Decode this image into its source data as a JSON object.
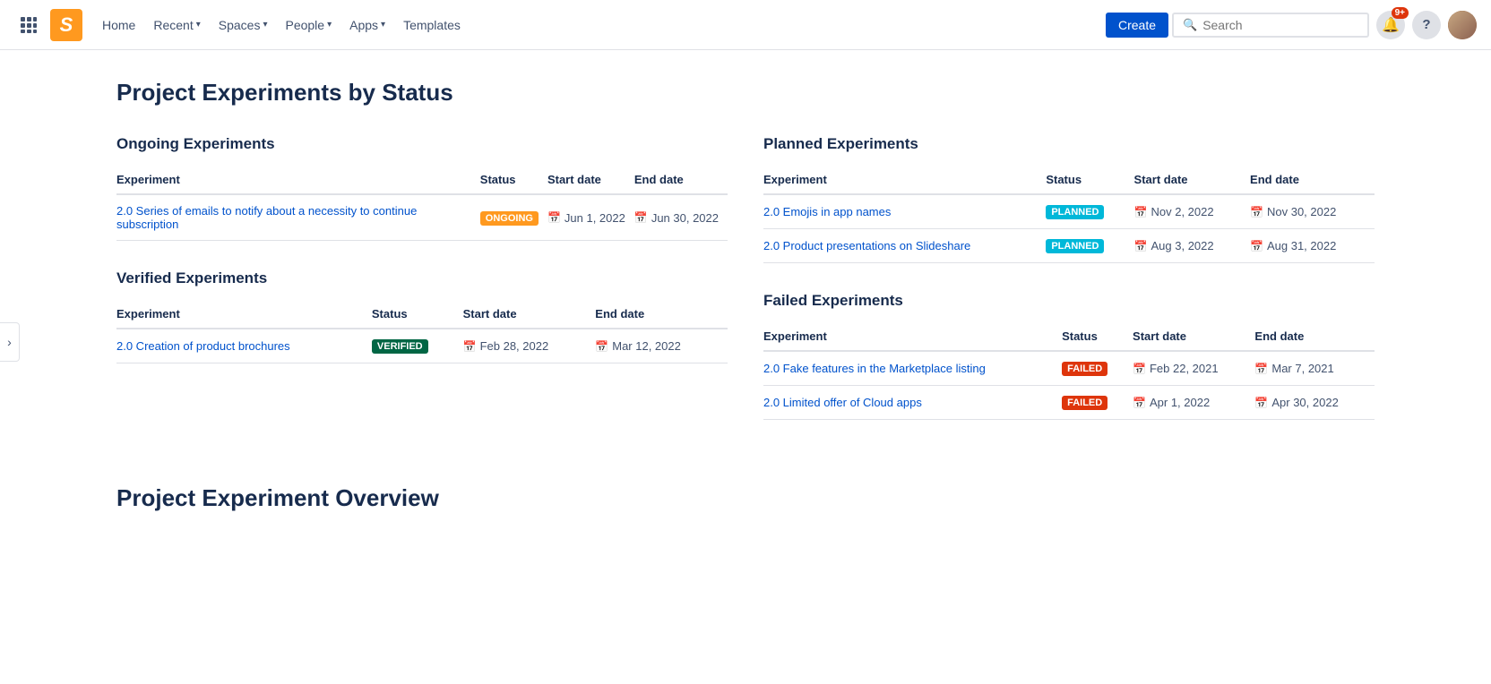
{
  "topnav": {
    "logo_letter": "S",
    "home_label": "Home",
    "recent_label": "Recent",
    "spaces_label": "Spaces",
    "people_label": "People",
    "apps_label": "Apps",
    "templates_label": "Templates",
    "create_label": "Create",
    "search_placeholder": "Search",
    "notif_count": "9+",
    "help_label": "?"
  },
  "page": {
    "title": "Project Experiments by Status",
    "overview_title": "Project Experiment Overview"
  },
  "ongoing": {
    "section_title": "Ongoing Experiments",
    "col_experiment": "Experiment",
    "col_status": "Status",
    "col_start": "Start date",
    "col_end": "End date",
    "rows": [
      {
        "name": "2.0 Series of emails to notify about a necessity to continue subscription",
        "status": "ONGOING",
        "status_type": "ongoing",
        "start": "Jun 1, 2022",
        "end": "Jun 30, 2022"
      }
    ]
  },
  "verified": {
    "section_title": "Verified Experiments",
    "col_experiment": "Experiment",
    "col_status": "Status",
    "col_start": "Start date",
    "col_end": "End date",
    "rows": [
      {
        "name": "2.0 Creation of product brochures",
        "status": "VERIFIED",
        "status_type": "verified",
        "start": "Feb 28, 2022",
        "end": "Mar 12, 2022"
      }
    ]
  },
  "planned": {
    "section_title": "Planned Experiments",
    "col_experiment": "Experiment",
    "col_status": "Status",
    "col_start": "Start date",
    "col_end": "End date",
    "rows": [
      {
        "name": "2.0 Emojis in app names",
        "status": "PLANNED",
        "status_type": "planned",
        "start": "Nov 2, 2022",
        "end": "Nov 30, 2022"
      },
      {
        "name": "2.0 Product presentations on Slideshare",
        "status": "PLANNED",
        "status_type": "planned",
        "start": "Aug 3, 2022",
        "end": "Aug 31, 2022"
      }
    ]
  },
  "failed": {
    "section_title": "Failed Experiments",
    "col_experiment": "Experiment",
    "col_status": "Status",
    "col_start": "Start date",
    "col_end": "End date",
    "rows": [
      {
        "name": "2.0 Fake features in the Marketplace listing",
        "status": "FAILED",
        "status_type": "failed",
        "start": "Feb 22, 2021",
        "end": "Mar 7, 2021"
      },
      {
        "name": "2.0 Limited offer of Cloud apps",
        "status": "FAILED",
        "status_type": "failed",
        "start": "Apr 1, 2022",
        "end": "Apr 30, 2022"
      }
    ]
  }
}
